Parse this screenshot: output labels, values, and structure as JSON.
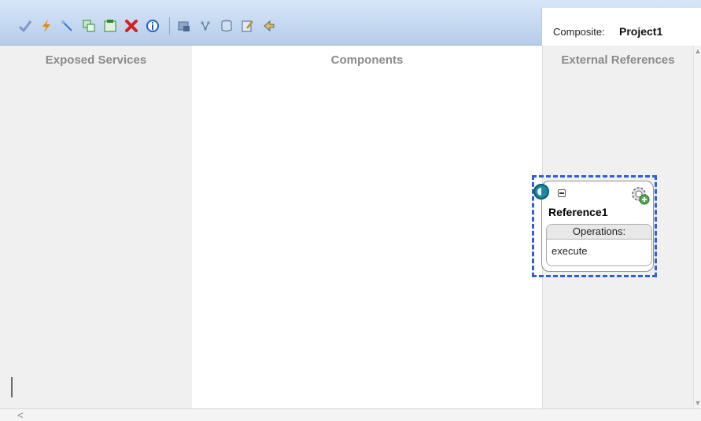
{
  "toolbar": {
    "icons": [
      {
        "name": "validate-checkmark-icon",
        "color": "#7a9acb"
      },
      {
        "name": "lightning-icon",
        "color": "#e58a00"
      },
      {
        "name": "wire-tool-icon",
        "color": "#3a78c8"
      },
      {
        "name": "copy-icon",
        "color": "#2f8a2f"
      },
      {
        "name": "paste-icon",
        "color": "#2f8a2f"
      },
      {
        "name": "delete-icon",
        "color": "#d32121"
      },
      {
        "name": "info-icon",
        "color": "#1f5fc4"
      },
      {
        "name": "deploy-icon",
        "color": "#4c6a91"
      },
      {
        "name": "layout-icon",
        "color": "#4c6a91"
      },
      {
        "name": "database-icon",
        "color": "#4c6a91"
      },
      {
        "name": "edit-icon",
        "color": "#4c6a91"
      },
      {
        "name": "test-run-icon",
        "color": "#4c6a91"
      }
    ],
    "composite_label": "Composite:",
    "composite_name": "Project1"
  },
  "columns": {
    "exposed_services": "Exposed Services",
    "components": "Components",
    "external_references": "External References"
  },
  "reference": {
    "name": "Reference1",
    "operations_header": "Operations:",
    "operations": [
      "execute"
    ]
  },
  "colors": {
    "selection_border": "#2f5fd0",
    "connector": "#1a8aa0",
    "panel_bg": "#f0f0f0"
  }
}
